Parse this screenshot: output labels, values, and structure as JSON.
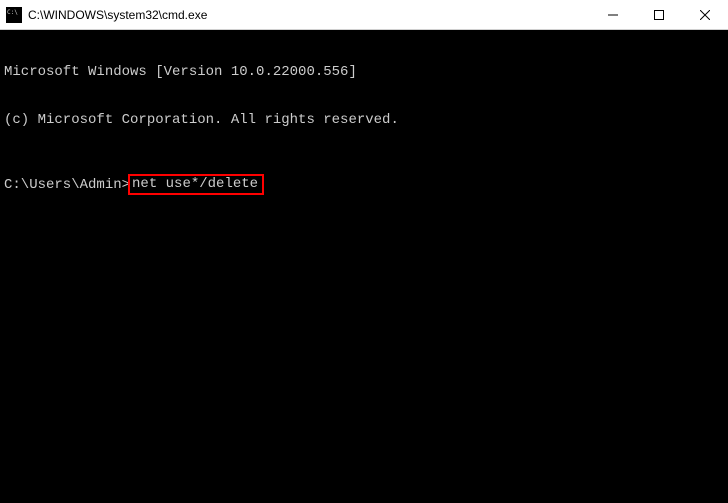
{
  "window": {
    "title": "C:\\WINDOWS\\system32\\cmd.exe"
  },
  "terminal": {
    "line1": "Microsoft Windows [Version 10.0.22000.556]",
    "line2": "(c) Microsoft Corporation. All rights reserved.",
    "prompt": "C:\\Users\\Admin>",
    "command": "net use*/delete"
  }
}
